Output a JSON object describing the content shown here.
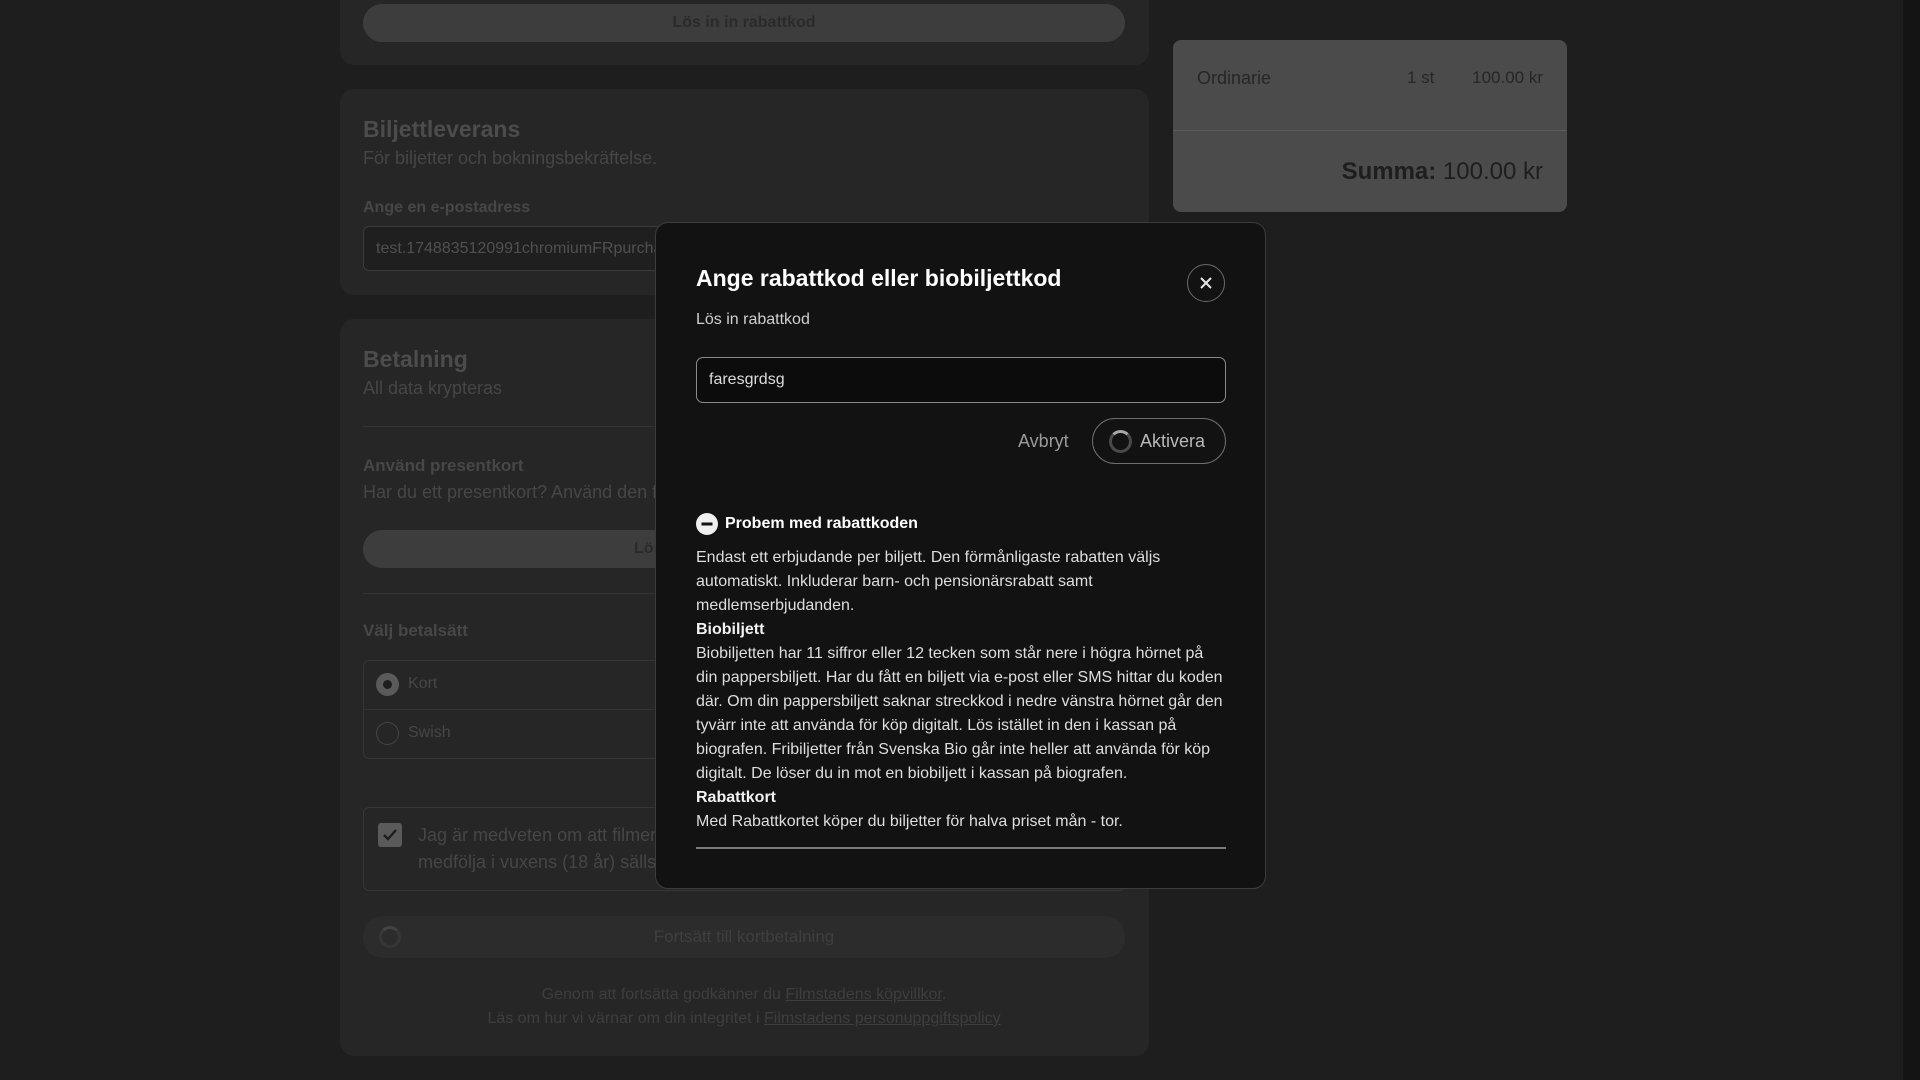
{
  "promo": {
    "redeem_button": "Lös in in rabattkod"
  },
  "delivery": {
    "title": "Biljettleverans",
    "subtitle": "För biljetter och bokningsbekräftelse.",
    "email_label": "Ange en e-postadress",
    "email_value": "test.1748835120991chromiumFRpurchas"
  },
  "payment": {
    "title": "Betalning",
    "subtitle": "All data krypteras",
    "giftcard_title": "Använd presentkort",
    "giftcard_text": "Har du ett presentkort? Använd den f",
    "giftcard_button": "Lös",
    "method_label": "Välj betalsätt",
    "methods": [
      {
        "label": "Kort",
        "selected": true
      },
      {
        "label": "Swish",
        "selected": false
      }
    ],
    "consent_line1": "Jag är medveten om att filmen",
    "consent_line2": "medfölja i vuxens (18 år) sällsk",
    "continue_button": "Fortsätt till kortbetalning",
    "terms_prefix": "Genom att fortsätta godkänner du ",
    "terms_link": "Filmstadens köpvillkor",
    "terms_suffix": ".",
    "privacy_prefix": "Läs om hur vi värnar om din integritet i ",
    "privacy_link": "Filmstadens personuppgiftspolicy"
  },
  "summary": {
    "ticket_type": "Ordinarie",
    "quantity": "1 st",
    "price": "100.00 kr",
    "total_label": "Summa:",
    "total_value": "100.00 kr"
  },
  "modal": {
    "title": "Ange rabattkod eller biobiljettkod",
    "subtitle": "Lös in rabattkod",
    "code_value": "faresgrdsg",
    "cancel_label": "Avbryt",
    "activate_label": "Aktivera",
    "help_title": "Probem med rabattkoden",
    "help_intro": "Endast ett erbjudande per biljett. Den förmånligaste rabatten väljs automatiskt. Inkluderar barn- och pensionärsrabatt samt medlemserbjudanden.",
    "biobiljett_heading": "Biobiljett",
    "biobiljett_text": "Biobiljetten har 11 siffror eller 12 tecken som står nere i högra hörnet på din pappersbiljett. Har du fått en biljett via e-post eller SMS hittar du koden där. Om din pappersbiljett saknar streckkod i nedre vänstra hörnet går den tyvärr inte att använda för köp digitalt. Lös istället in den i kassan på biografen. Fribiljetter från Svenska Bio går inte heller att använda för köp digitalt. De löser du in mot en biobiljett i kassan på biografen.",
    "rabattkort_heading": "Rabattkort",
    "rabattkort_text": "Med Rabattkortet köper du biljetter för halva priset mån - tor."
  },
  "icons": {
    "close": "close-icon",
    "spinner": "spinner-icon",
    "minus": "minus-circle-icon",
    "check": "checkmark-icon"
  }
}
